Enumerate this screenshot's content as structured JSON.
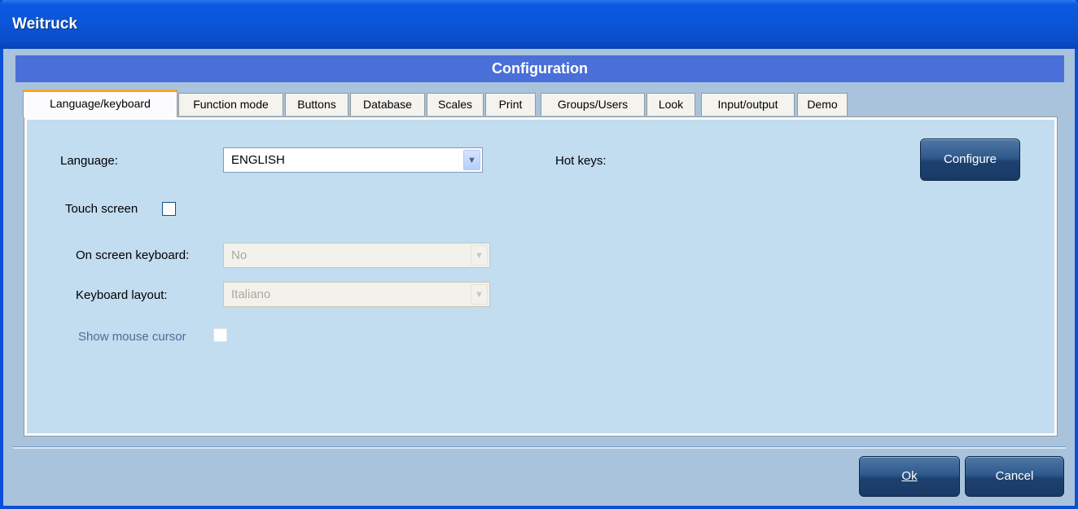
{
  "window": {
    "title": "Weitruck"
  },
  "header": {
    "title": "Configuration"
  },
  "tabs": [
    {
      "label": "Language/keyboard",
      "active": true
    },
    {
      "label": "Function mode"
    },
    {
      "label": "Buttons"
    },
    {
      "label": "Database"
    },
    {
      "label": "Scales"
    },
    {
      "label": "Print"
    },
    {
      "label": "Groups/Users"
    },
    {
      "label": "Look"
    },
    {
      "label": "Input/output"
    },
    {
      "label": "Demo"
    }
  ],
  "form": {
    "language_label": "Language:",
    "language_value": "ENGLISH",
    "hotkeys_label": "Hot keys:",
    "configure_label": "Configure",
    "touch_label": "Touch screen",
    "osk_label": "On screen keyboard:",
    "osk_value": "No",
    "layout_label": "Keyboard layout:",
    "layout_value": "Italiano",
    "mouse_label": "Show mouse cursor"
  },
  "footer": {
    "ok_label": "Ok",
    "cancel_label": "Cancel"
  },
  "icons": {
    "dropdown": "chevron-down-icon"
  },
  "colors": {
    "titlebar": "#0a55d8",
    "header": "#4a6fd9",
    "panel": "#c2dcf0",
    "button": "#2f5a8d",
    "active_tab_accent": "#f6a623"
  }
}
